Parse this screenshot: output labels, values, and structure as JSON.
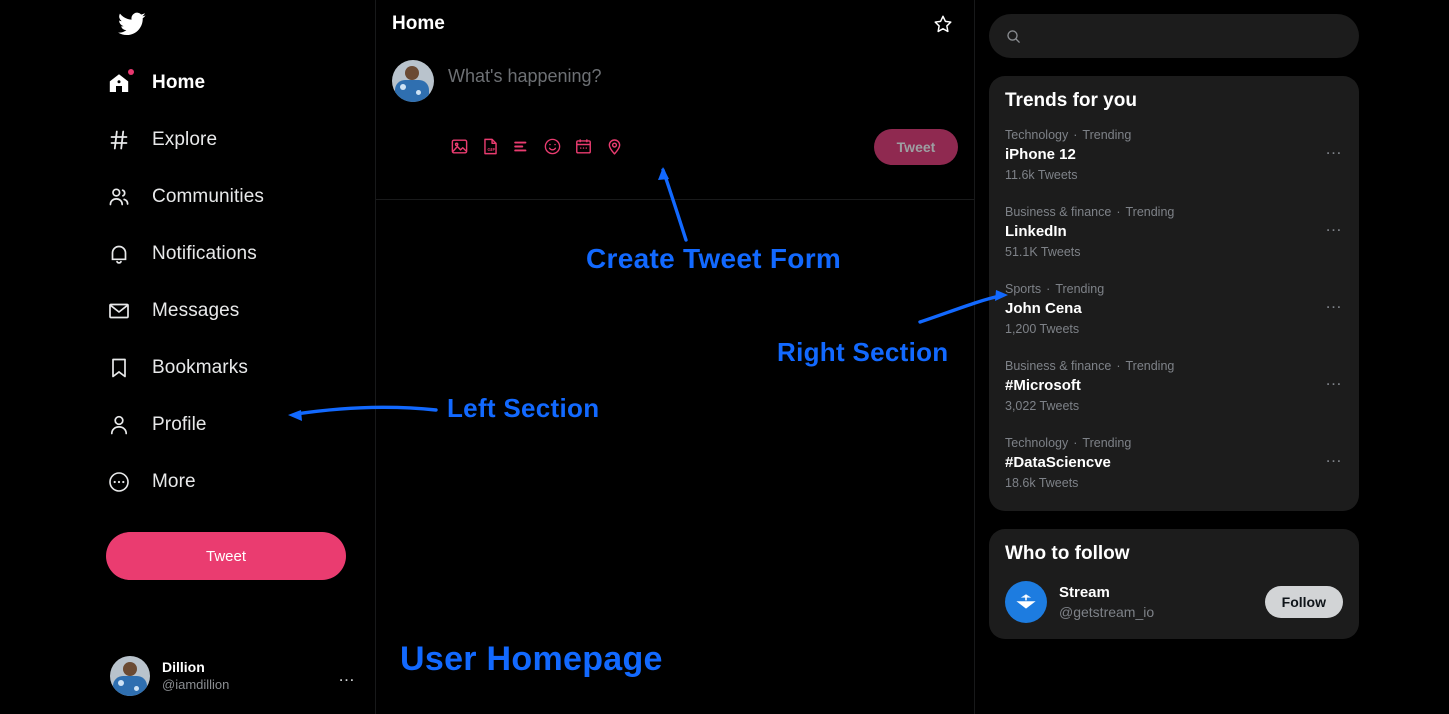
{
  "brand": {
    "logo_icon": "twitter-bird-icon",
    "accent_pink": "#ea3c70",
    "annotation_blue": "#1269ff",
    "card_bg": "#1c1c1c",
    "page_bg": "#000000"
  },
  "sidebar": {
    "items": [
      {
        "label": "Home",
        "icon": "home-icon",
        "active": true,
        "badge_dot": true
      },
      {
        "label": "Explore",
        "icon": "hashtag-icon",
        "active": false,
        "badge_dot": false
      },
      {
        "label": "Communities",
        "icon": "communities-icon",
        "active": false,
        "badge_dot": false
      },
      {
        "label": "Notifications",
        "icon": "bell-icon",
        "active": false,
        "badge_dot": false
      },
      {
        "label": "Messages",
        "icon": "envelope-icon",
        "active": false,
        "badge_dot": false
      },
      {
        "label": "Bookmarks",
        "icon": "bookmark-icon",
        "active": false,
        "badge_dot": false
      },
      {
        "label": "Profile",
        "icon": "person-icon",
        "active": false,
        "badge_dot": false
      },
      {
        "label": "More",
        "icon": "more-circle-icon",
        "active": false,
        "badge_dot": false
      }
    ],
    "tweet_button": "Tweet",
    "account": {
      "name": "Dillion",
      "handle": "@iamdillion",
      "menu_icon": "ellipsis-icon",
      "avatar": "user-avatar"
    }
  },
  "main": {
    "title": "Home",
    "top_tweets_icon": "star-icon",
    "compose": {
      "placeholder": "What's happening?",
      "value": "",
      "avatar": "user-avatar",
      "tweet_button": "Tweet",
      "icons": [
        {
          "name": "image-icon"
        },
        {
          "name": "gif-icon"
        },
        {
          "name": "poll-icon"
        },
        {
          "name": "emoji-icon"
        },
        {
          "name": "schedule-icon"
        },
        {
          "name": "location-icon"
        }
      ]
    }
  },
  "right": {
    "search": {
      "placeholder": "",
      "value": "",
      "icon": "search-icon"
    },
    "trends": {
      "title": "Trends for you",
      "items": [
        {
          "category": "Technology",
          "status": "Trending",
          "name": "iPhone 12",
          "count": "11.6k Tweets"
        },
        {
          "category": "Business & finance",
          "status": "Trending",
          "name": "LinkedIn",
          "count": "51.1K Tweets"
        },
        {
          "category": "Sports",
          "status": "Trending",
          "name": "John Cena",
          "count": "1,200 Tweets"
        },
        {
          "category": "Business & finance",
          "status": "Trending",
          "name": "#Microsoft",
          "count": "3,022 Tweets"
        },
        {
          "category": "Technology",
          "status": "Trending",
          "name": "#DataSciencve",
          "count": "18.6k Tweets"
        }
      ],
      "separator": "·",
      "menu_icon": "ellipsis-icon"
    },
    "who_to_follow": {
      "title": "Who to follow",
      "accounts": [
        {
          "name": "Stream",
          "handle": "@getstream_io",
          "follow_label": "Follow",
          "avatar": "stream-logo"
        }
      ]
    }
  },
  "annotations": [
    {
      "id": "create",
      "text": "Create Tweet Form"
    },
    {
      "id": "left",
      "text": "Left Section"
    },
    {
      "id": "right",
      "text": "Right Section"
    },
    {
      "id": "home",
      "text": "User Homepage"
    }
  ]
}
